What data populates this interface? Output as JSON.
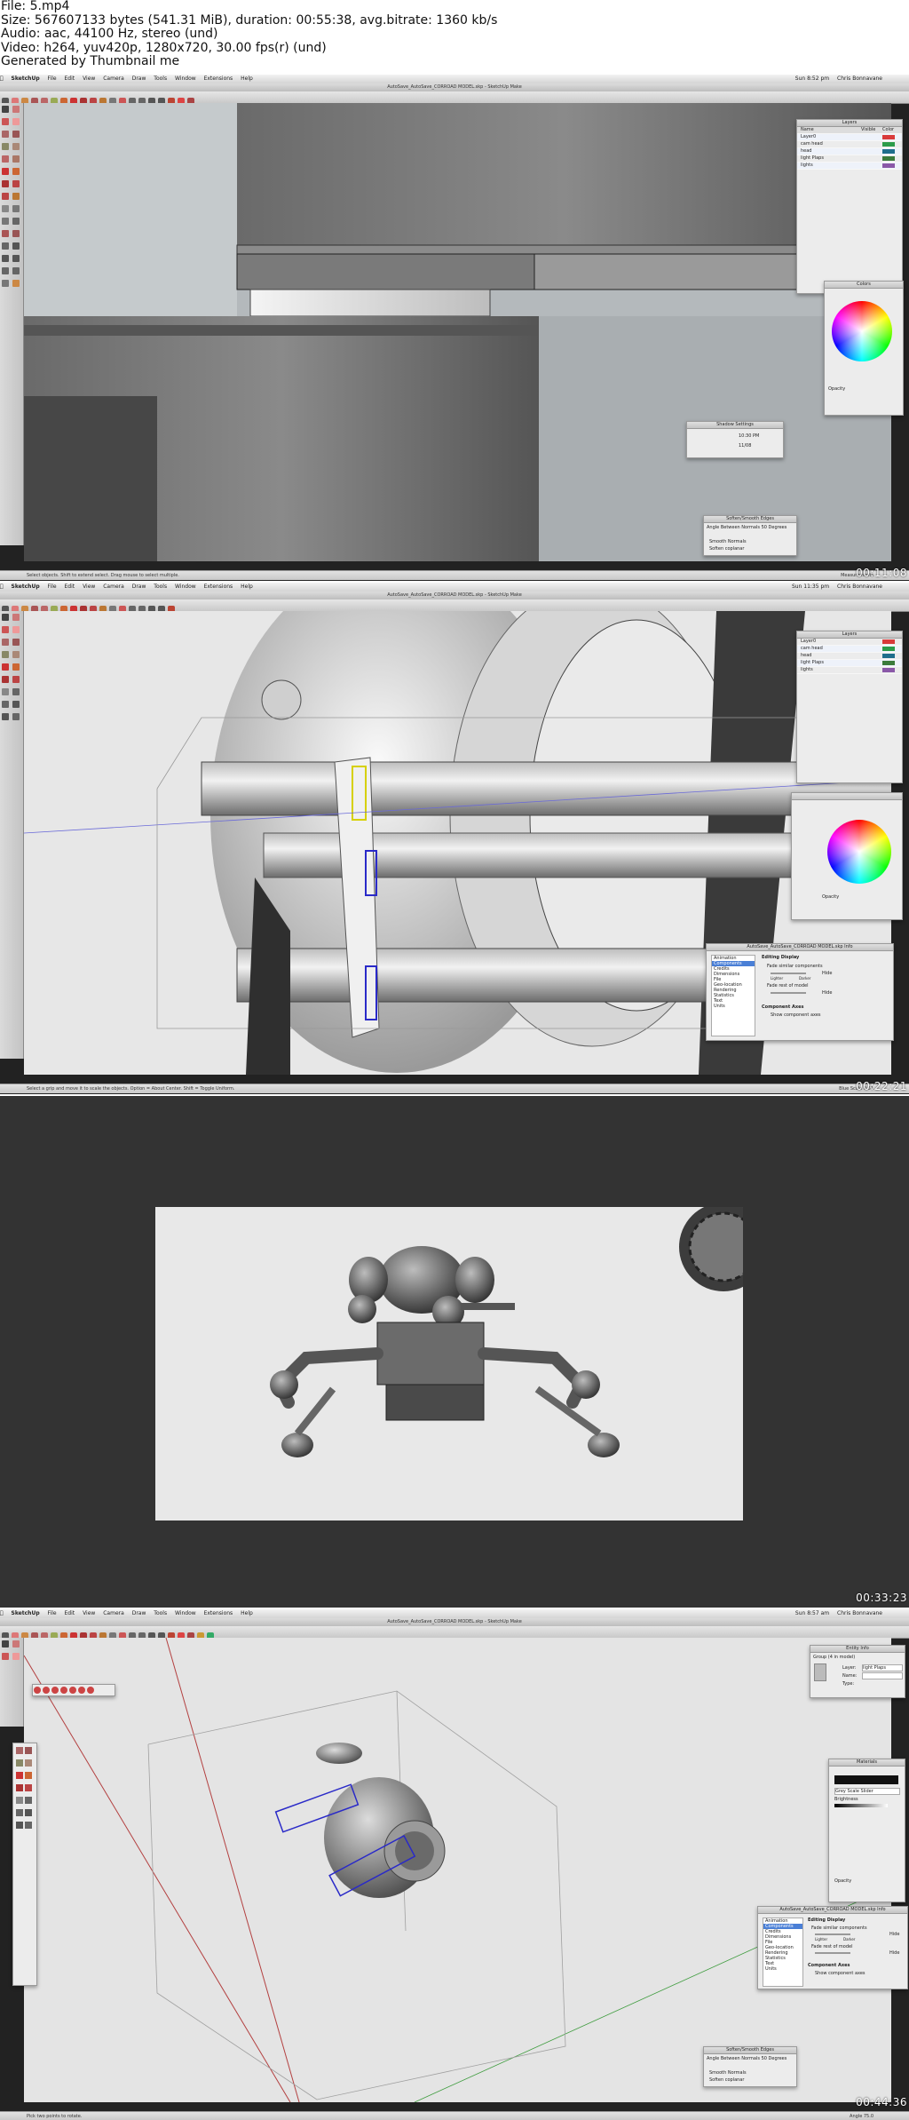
{
  "header": {
    "file": "File: 5.mp4",
    "size": "Size: 567607133 bytes (541.31 MiB), duration: 00:55:38, avg.bitrate: 1360 kb/s",
    "audio": "Audio: aac, 44100 Hz, stereo (und)",
    "video": "Video: h264, yuv420p, 1280x720, 30.00 fps(r) (und)",
    "generated": "Generated by Thumbnail me"
  },
  "menu_items": [
    "SketchUp",
    "File",
    "Edit",
    "View",
    "Camera",
    "Draw",
    "Tools",
    "Window",
    "Extensions",
    "Help"
  ],
  "menu_right": "Chris Bonnavane",
  "frames": [
    {
      "timestamp": "00:11:08",
      "window_title": "AutoSave_AutoSave_CORROAD MODEL.skp - SketchUp Make",
      "clock": "Sun 8:52 pm",
      "status_text": "Select objects. Shift to extend select. Drag mouse to select multiple.",
      "status_right": "Measurements",
      "layers_title": "Layers",
      "layers_headers": [
        "Name",
        "Visible",
        "Color"
      ],
      "layers": [
        {
          "name": "Layer0",
          "color": "#d93a3a"
        },
        {
          "name": "cam head",
          "color": "#2c9c4a"
        },
        {
          "name": "head",
          "color": "#1f6e8c"
        },
        {
          "name": "light Plaps",
          "color": "#3b7b3b"
        },
        {
          "name": "lights",
          "color": "#8a58a8"
        }
      ],
      "colors_title": "Colors",
      "colors_opacity": "Opacity",
      "shadow_title": "Shadow Settings",
      "shadow_time": "10:30 PM",
      "shadow_date": "11/08",
      "soften_title": "Soften/Smooth Edges",
      "soften_angle_label": "Angle Between Normals",
      "soften_angle_value": "50  Degrees",
      "soften_smooth": "Smooth Normals",
      "soften_coplanar": "Soften coplanar"
    },
    {
      "timestamp": "00:22:21",
      "window_title": "AutoSave_AutoSave_CORROAD MODEL.skp - SketchUp Make",
      "clock": "Sun 11:35 pm",
      "status_text": "Select a grip and move it to scale the objects. Option = About Center. Shift = Toggle Uniform.",
      "status_right": "Blue Scale  0.51",
      "layers_title": "Layers",
      "layers": [
        {
          "name": "Layer0",
          "color": "#d93a3a"
        },
        {
          "name": "cam head",
          "color": "#2c9c4a"
        },
        {
          "name": "head",
          "color": "#1f6e8c"
        },
        {
          "name": "light Plaps",
          "color": "#3b7b3b"
        },
        {
          "name": "lights",
          "color": "#8a58a8"
        }
      ],
      "colors_opacity": "Opacity",
      "model_info_title": "AutoSave_AutoSave_CORROAD MODEL.skp Info",
      "model_info_list": [
        "Animation",
        "Components",
        "Credits",
        "Dimensions",
        "File",
        "Geo-location",
        "Rendering",
        "Statistics",
        "Text",
        "Units"
      ],
      "editing_display": "Editing Display",
      "fade_similar": "Fade similar components",
      "fade_rest": "Fade rest of model",
      "hide": "Hide",
      "lighter": "Lighter",
      "darker": "Darker",
      "component_axes": "Component Axes",
      "show_component_axes": "Show component axes"
    },
    {
      "timestamp": "00:33:23"
    },
    {
      "timestamp": "00:44:36",
      "window_title": "AutoSave_AutoSave_CORROAD MODEL.skp - SketchUp Make",
      "clock": "Sun 8:57 am",
      "status_text": "Pick two points to rotate.",
      "status_right": "Angle   75.0",
      "entity_title": "Entity Info",
      "entity_group": "Group (4 in model)",
      "entity_layer_label": "Layer:",
      "entity_layer_value": "light Plaps",
      "entity_name_label": "Name:",
      "entity_type_label": "Type:",
      "materials_title": "Materials",
      "materials_select": "Grey Scale Slider",
      "materials_brightness": "Brightness",
      "materials_opacity": "Opacity",
      "model_info_title": "AutoSave_AutoSave_CORROAD MODEL.skp Info",
      "model_info_list": [
        "Animation",
        "Components",
        "Credits",
        "Dimensions",
        "File",
        "Geo-location",
        "Rendering",
        "Statistics",
        "Text",
        "Units"
      ],
      "editing_display": "Editing Display",
      "fade_similar": "Fade similar components",
      "fade_rest": "Fade rest of model",
      "hide": "Hide",
      "lighter": "Lighter",
      "darker": "Darker",
      "component_axes": "Component Axes",
      "show_component_axes": "Show component axes",
      "soften_title": "Soften/Smooth Edges",
      "soften_angle_label": "Angle Between Normals",
      "soften_angle_value": "50  Degrees",
      "soften_smooth": "Smooth Normals",
      "soften_coplanar": "Soften coplanar"
    }
  ]
}
